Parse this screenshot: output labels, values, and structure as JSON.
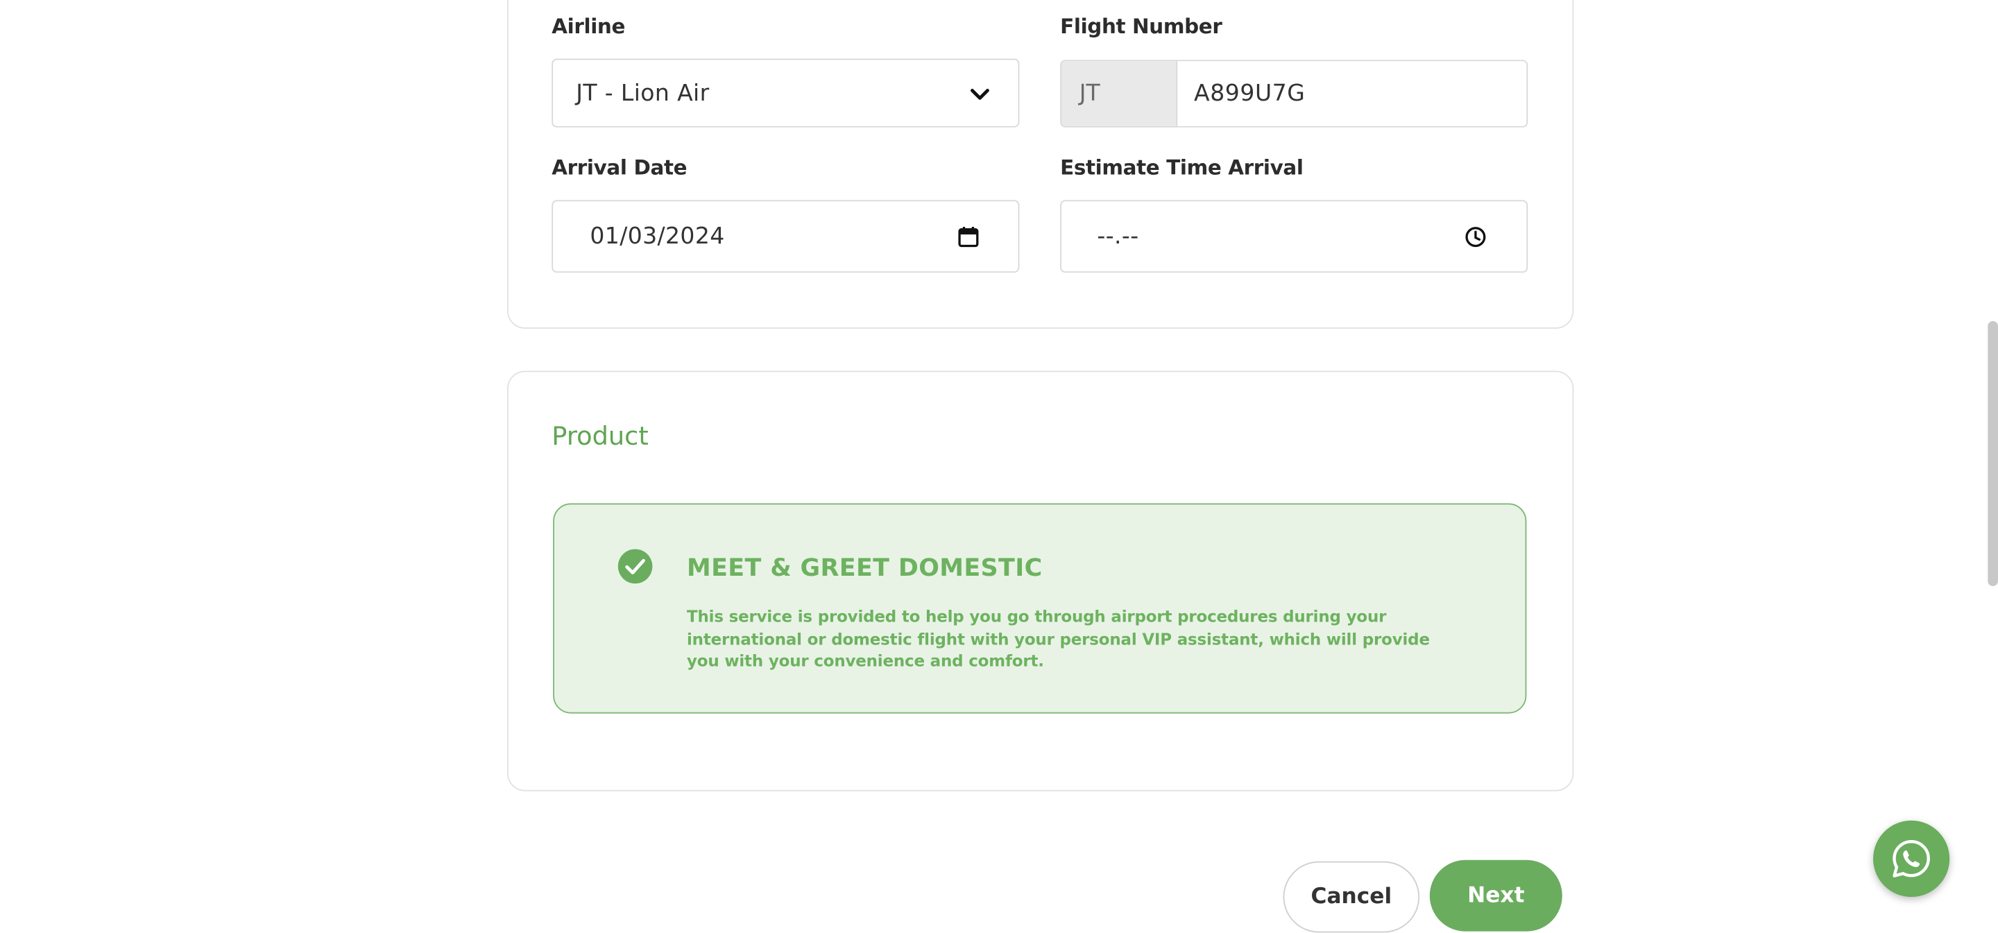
{
  "flight": {
    "airline_label": "Airline",
    "airline_value": "JT - Lion Air",
    "flight_number_label": "Flight Number",
    "flight_prefix": "JT",
    "flight_number_value": "A899U7G",
    "arrival_date_label": "Arrival Date",
    "arrival_date_value": "01/03/2024",
    "eta_label": "Estimate Time Arrival",
    "eta_value": "--.--"
  },
  "product": {
    "section_title": "Product",
    "item": {
      "title": "MEET & GREET DOMESTIC",
      "description": "This service is provided to help you go through airport procedures during your international or domestic flight with your personal VIP assistant, which will provide you with your convenience and comfort.",
      "selected": true
    }
  },
  "actions": {
    "cancel_label": "Cancel",
    "next_label": "Next"
  },
  "icons": {
    "select": "chevron-down-icon",
    "date": "calendar-icon",
    "time": "clock-icon",
    "selected": "check-circle-icon",
    "chat": "whatsapp-icon"
  },
  "colors": {
    "accent": "#6aad5f",
    "accent_text": "#6db25f",
    "product_bg": "#e8f3e6"
  }
}
